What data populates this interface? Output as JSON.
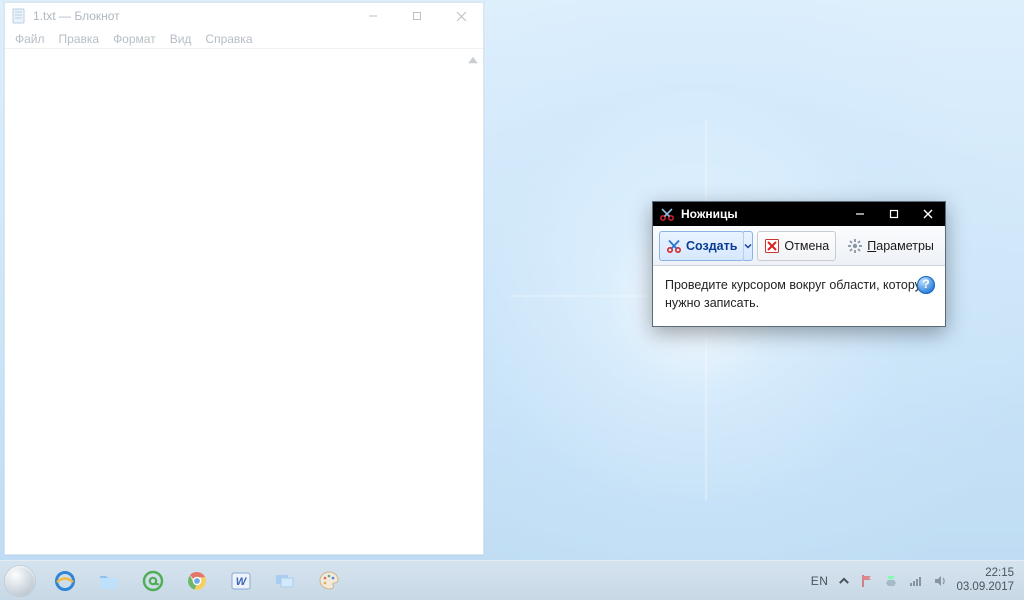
{
  "notepad": {
    "title": "1.txt — Блокнот",
    "menu": {
      "file": "Файл",
      "edit": "Правка",
      "format": "Формат",
      "view": "Вид",
      "help": "Справка"
    }
  },
  "snip": {
    "title": "Ножницы",
    "toolbar": {
      "new": "Создать",
      "cancel": "Отмена",
      "options": "Параметры",
      "options_underline": "П"
    },
    "instruction": "Проведите курсором вокруг области, которую нужно записать."
  },
  "taskbar": {
    "lang": "EN",
    "time": "22:15",
    "date": "03.09.2017"
  }
}
